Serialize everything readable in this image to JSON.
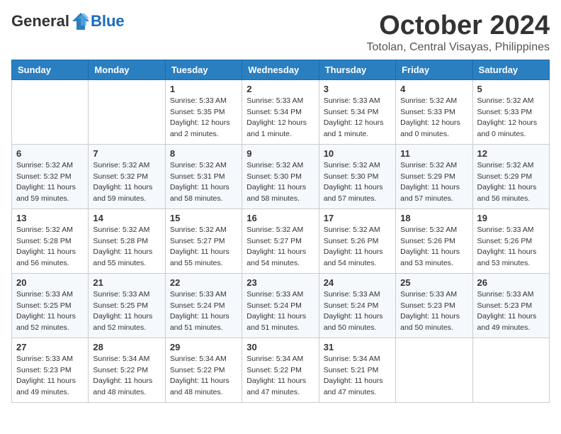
{
  "header": {
    "logo_general": "General",
    "logo_blue": "Blue",
    "month_title": "October 2024",
    "location": "Totolan, Central Visayas, Philippines"
  },
  "days_of_week": [
    "Sunday",
    "Monday",
    "Tuesday",
    "Wednesday",
    "Thursday",
    "Friday",
    "Saturday"
  ],
  "weeks": [
    [
      {
        "day": "",
        "info": ""
      },
      {
        "day": "",
        "info": ""
      },
      {
        "day": "1",
        "info": "Sunrise: 5:33 AM\nSunset: 5:35 PM\nDaylight: 12 hours and 2 minutes."
      },
      {
        "day": "2",
        "info": "Sunrise: 5:33 AM\nSunset: 5:34 PM\nDaylight: 12 hours and 1 minute."
      },
      {
        "day": "3",
        "info": "Sunrise: 5:33 AM\nSunset: 5:34 PM\nDaylight: 12 hours and 1 minute."
      },
      {
        "day": "4",
        "info": "Sunrise: 5:32 AM\nSunset: 5:33 PM\nDaylight: 12 hours and 0 minutes."
      },
      {
        "day": "5",
        "info": "Sunrise: 5:32 AM\nSunset: 5:33 PM\nDaylight: 12 hours and 0 minutes."
      }
    ],
    [
      {
        "day": "6",
        "info": "Sunrise: 5:32 AM\nSunset: 5:32 PM\nDaylight: 11 hours and 59 minutes."
      },
      {
        "day": "7",
        "info": "Sunrise: 5:32 AM\nSunset: 5:32 PM\nDaylight: 11 hours and 59 minutes."
      },
      {
        "day": "8",
        "info": "Sunrise: 5:32 AM\nSunset: 5:31 PM\nDaylight: 11 hours and 58 minutes."
      },
      {
        "day": "9",
        "info": "Sunrise: 5:32 AM\nSunset: 5:30 PM\nDaylight: 11 hours and 58 minutes."
      },
      {
        "day": "10",
        "info": "Sunrise: 5:32 AM\nSunset: 5:30 PM\nDaylight: 11 hours and 57 minutes."
      },
      {
        "day": "11",
        "info": "Sunrise: 5:32 AM\nSunset: 5:29 PM\nDaylight: 11 hours and 57 minutes."
      },
      {
        "day": "12",
        "info": "Sunrise: 5:32 AM\nSunset: 5:29 PM\nDaylight: 11 hours and 56 minutes."
      }
    ],
    [
      {
        "day": "13",
        "info": "Sunrise: 5:32 AM\nSunset: 5:28 PM\nDaylight: 11 hours and 56 minutes."
      },
      {
        "day": "14",
        "info": "Sunrise: 5:32 AM\nSunset: 5:28 PM\nDaylight: 11 hours and 55 minutes."
      },
      {
        "day": "15",
        "info": "Sunrise: 5:32 AM\nSunset: 5:27 PM\nDaylight: 11 hours and 55 minutes."
      },
      {
        "day": "16",
        "info": "Sunrise: 5:32 AM\nSunset: 5:27 PM\nDaylight: 11 hours and 54 minutes."
      },
      {
        "day": "17",
        "info": "Sunrise: 5:32 AM\nSunset: 5:26 PM\nDaylight: 11 hours and 54 minutes."
      },
      {
        "day": "18",
        "info": "Sunrise: 5:32 AM\nSunset: 5:26 PM\nDaylight: 11 hours and 53 minutes."
      },
      {
        "day": "19",
        "info": "Sunrise: 5:33 AM\nSunset: 5:26 PM\nDaylight: 11 hours and 53 minutes."
      }
    ],
    [
      {
        "day": "20",
        "info": "Sunrise: 5:33 AM\nSunset: 5:25 PM\nDaylight: 11 hours and 52 minutes."
      },
      {
        "day": "21",
        "info": "Sunrise: 5:33 AM\nSunset: 5:25 PM\nDaylight: 11 hours and 52 minutes."
      },
      {
        "day": "22",
        "info": "Sunrise: 5:33 AM\nSunset: 5:24 PM\nDaylight: 11 hours and 51 minutes."
      },
      {
        "day": "23",
        "info": "Sunrise: 5:33 AM\nSunset: 5:24 PM\nDaylight: 11 hours and 51 minutes."
      },
      {
        "day": "24",
        "info": "Sunrise: 5:33 AM\nSunset: 5:24 PM\nDaylight: 11 hours and 50 minutes."
      },
      {
        "day": "25",
        "info": "Sunrise: 5:33 AM\nSunset: 5:23 PM\nDaylight: 11 hours and 50 minutes."
      },
      {
        "day": "26",
        "info": "Sunrise: 5:33 AM\nSunset: 5:23 PM\nDaylight: 11 hours and 49 minutes."
      }
    ],
    [
      {
        "day": "27",
        "info": "Sunrise: 5:33 AM\nSunset: 5:23 PM\nDaylight: 11 hours and 49 minutes."
      },
      {
        "day": "28",
        "info": "Sunrise: 5:34 AM\nSunset: 5:22 PM\nDaylight: 11 hours and 48 minutes."
      },
      {
        "day": "29",
        "info": "Sunrise: 5:34 AM\nSunset: 5:22 PM\nDaylight: 11 hours and 48 minutes."
      },
      {
        "day": "30",
        "info": "Sunrise: 5:34 AM\nSunset: 5:22 PM\nDaylight: 11 hours and 47 minutes."
      },
      {
        "day": "31",
        "info": "Sunrise: 5:34 AM\nSunset: 5:21 PM\nDaylight: 11 hours and 47 minutes."
      },
      {
        "day": "",
        "info": ""
      },
      {
        "day": "",
        "info": ""
      }
    ]
  ]
}
